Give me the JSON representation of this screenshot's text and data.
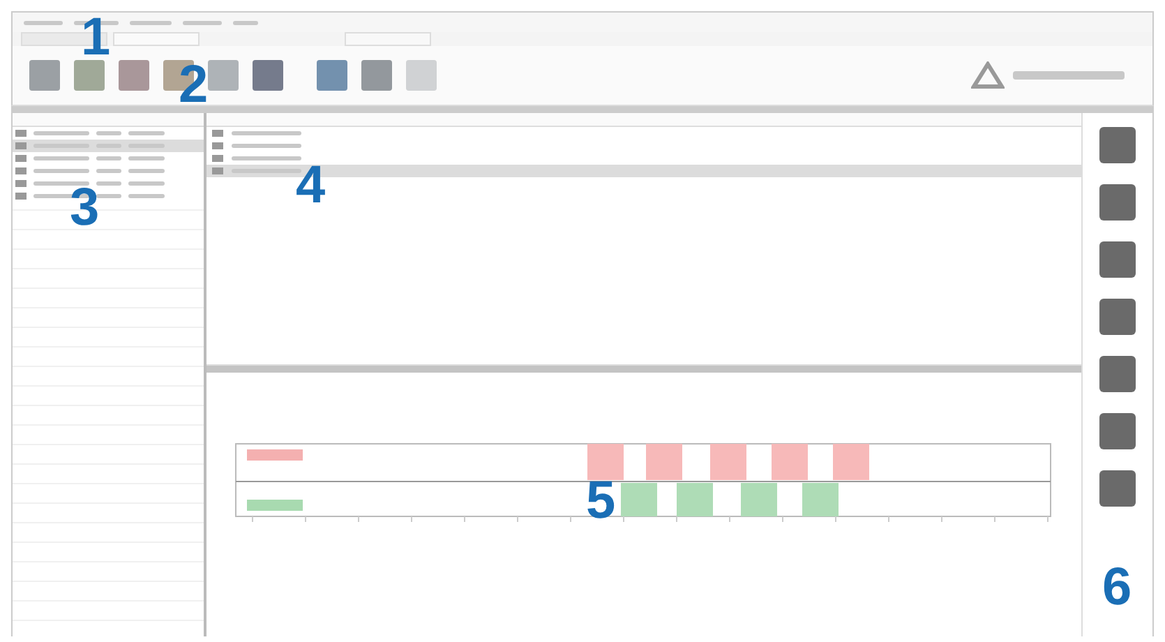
{
  "callouts": [
    {
      "label": "1"
    },
    {
      "label": "2"
    },
    {
      "label": "3"
    },
    {
      "label": "4"
    },
    {
      "label": "5"
    },
    {
      "label": "6"
    }
  ],
  "patient_list": {
    "rows": [
      {
        "selected": false
      },
      {
        "selected": true
      },
      {
        "selected": false
      },
      {
        "selected": false
      },
      {
        "selected": false
      },
      {
        "selected": false
      }
    ]
  },
  "session_table": {
    "rows": [
      {
        "selected": false
      },
      {
        "selected": false
      },
      {
        "selected": false
      },
      {
        "selected": true
      }
    ]
  }
}
